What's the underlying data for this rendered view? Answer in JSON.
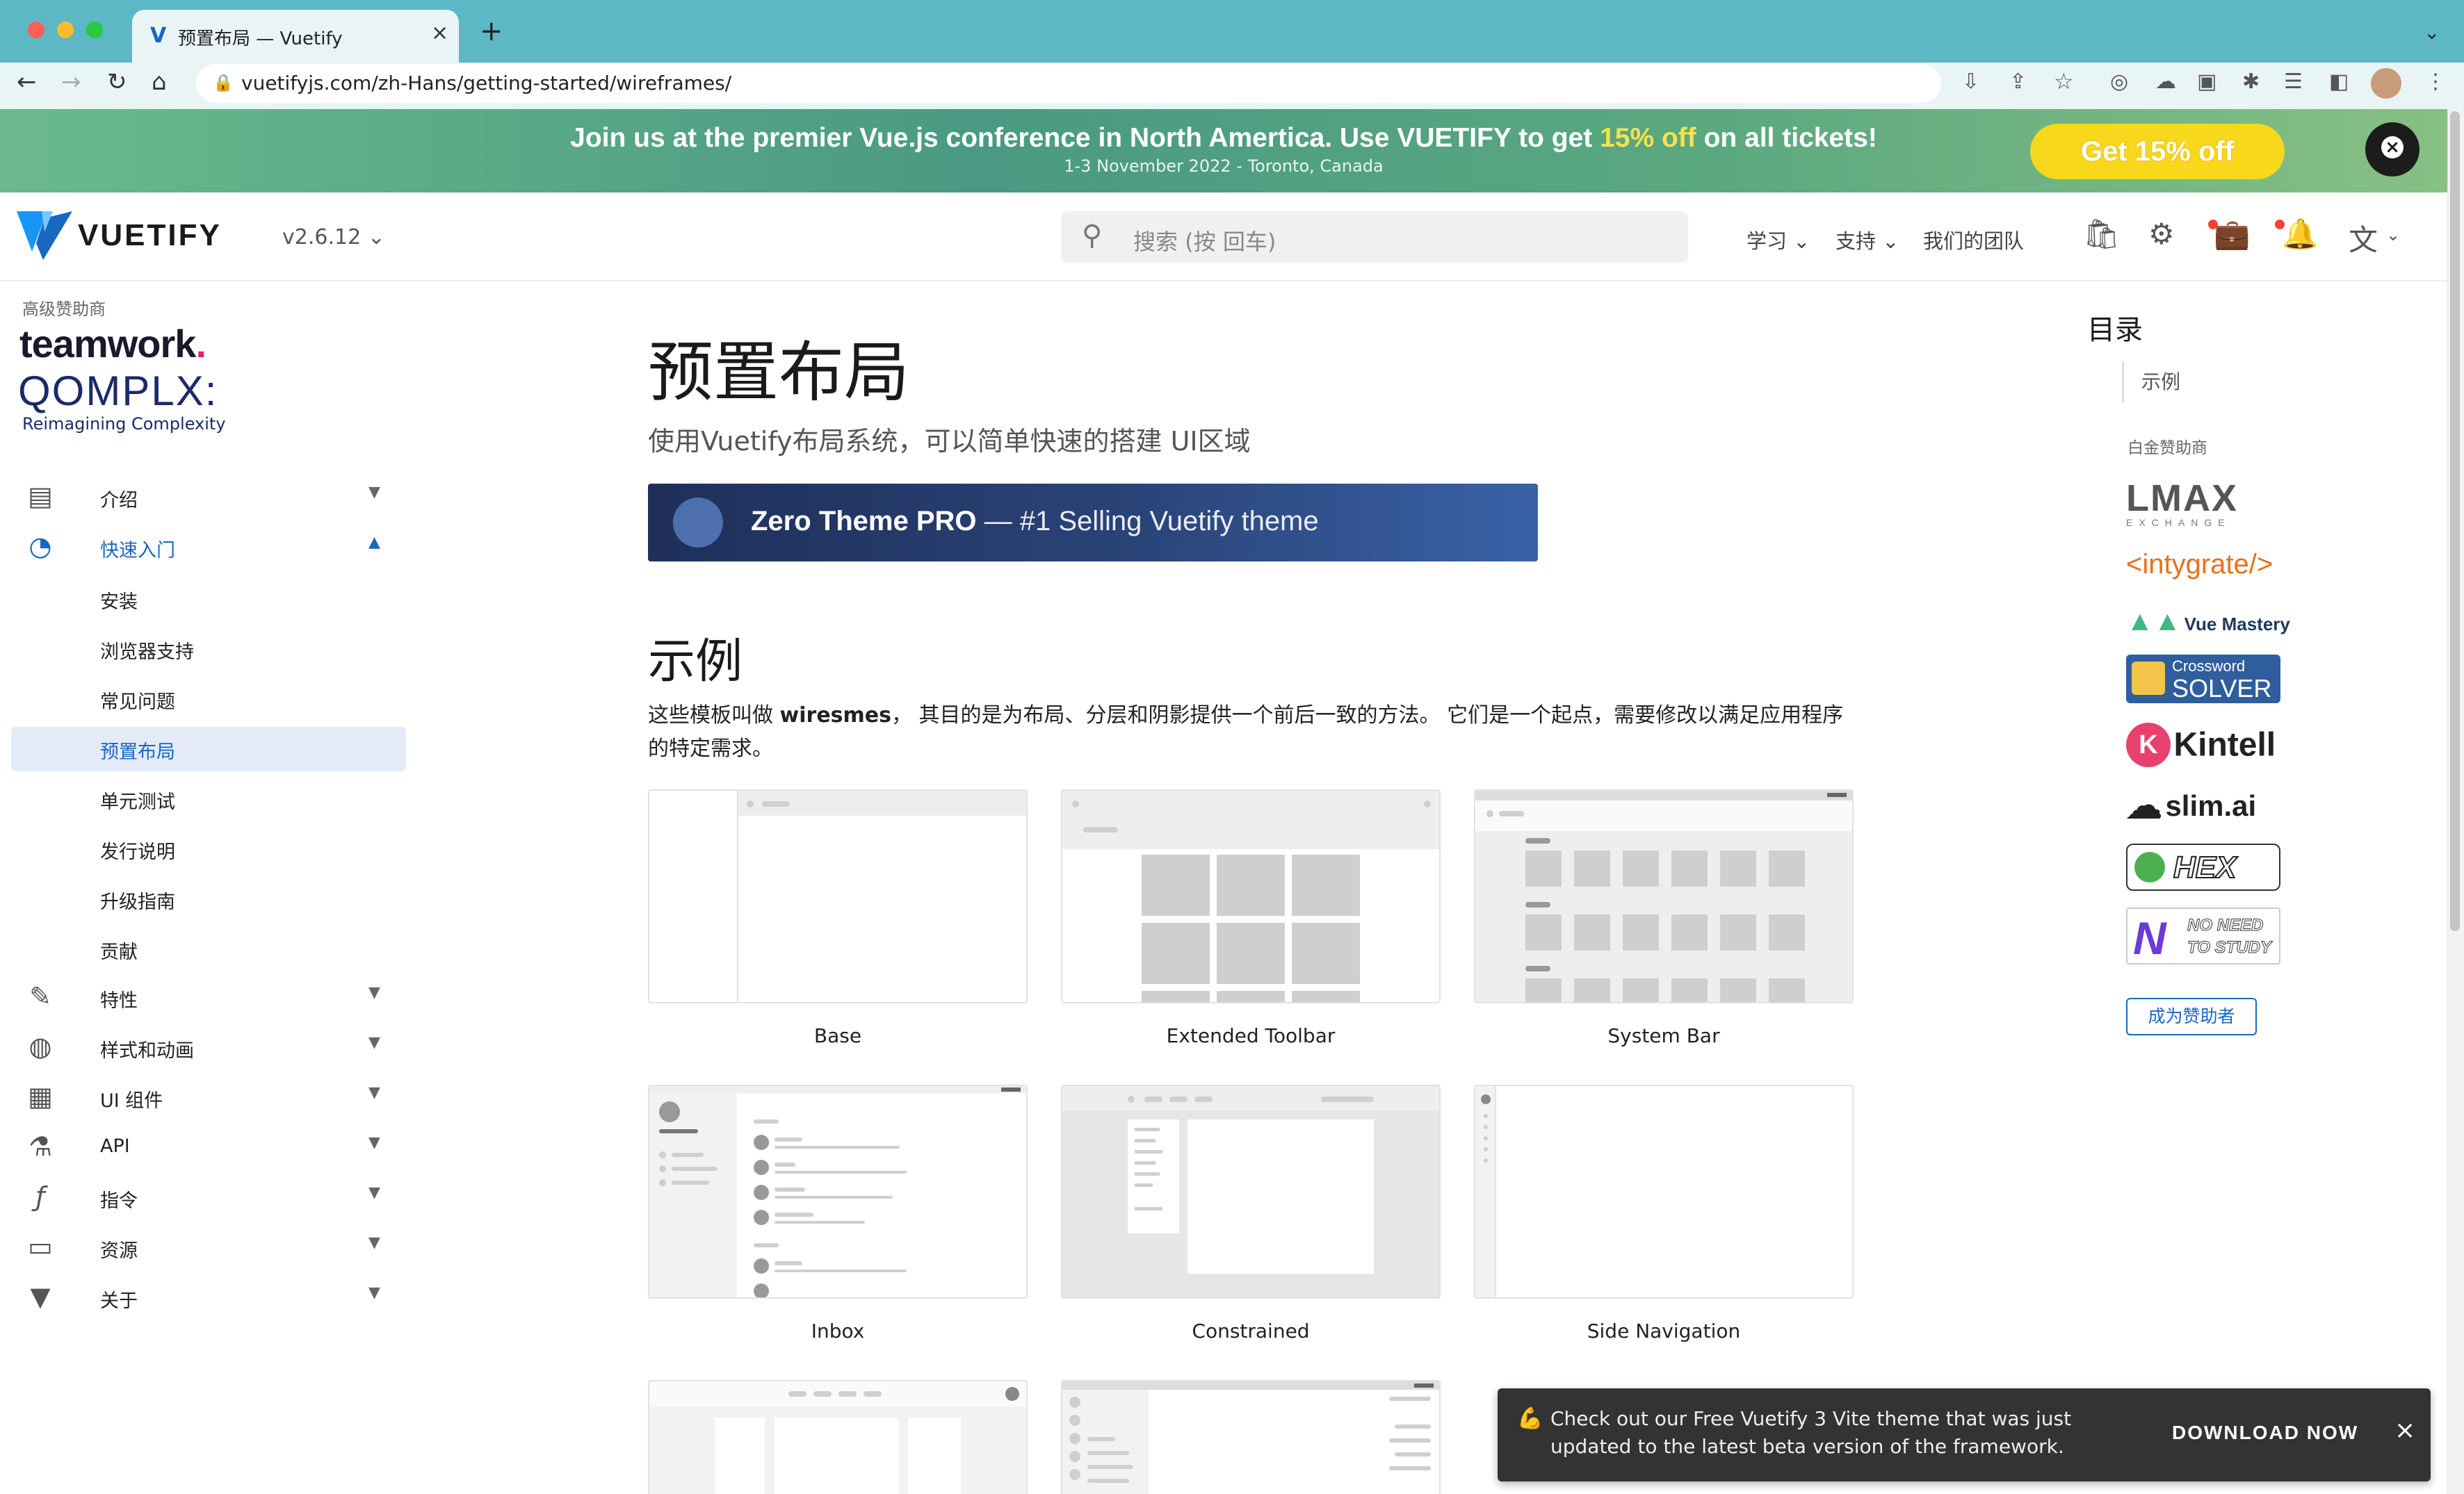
{
  "browser": {
    "tab_title": "预置布局 — Vuetify",
    "url": "vuetifyjs.com/zh-Hans/getting-started/wireframes/",
    "new_tab": "+",
    "back": "←",
    "forward": "→",
    "reload": "↻",
    "home": "⌂"
  },
  "promo": {
    "text_before": "Join us at the premier Vue.js conference in North Amertica. Use VUETIFY to get ",
    "highlight": "15% off",
    "text_after": " on all tickets!",
    "subtitle": "1-3 November 2022 - Toronto, Canada",
    "button": "Get 15% off",
    "close": "×",
    "accent": "#f7d81c"
  },
  "header": {
    "brand": "VUETIFY",
    "version": "v2.6.12",
    "search_placeholder": "搜索 (按 回车)",
    "nav": [
      "学习",
      "支持",
      "我们的团队"
    ]
  },
  "sidebar": {
    "premium_title": "高级赞助商",
    "sponsor1": "teamwork",
    "sponsor2": "QOMPLX:",
    "sponsor2_tagline": "Reimagining Complexity",
    "items": [
      {
        "label": "介绍",
        "icon": "book-icon"
      },
      {
        "label": "快速入门",
        "icon": "speedometer-icon"
      },
      {
        "label": "特性",
        "icon": "pencil-icon"
      },
      {
        "label": "样式和动画",
        "icon": "palette-icon"
      },
      {
        "label": "UI 组件",
        "icon": "grid-icon"
      },
      {
        "label": "API",
        "icon": "flask-icon"
      },
      {
        "label": "指令",
        "icon": "function-icon"
      },
      {
        "label": "资源",
        "icon": "presenter-icon"
      },
      {
        "label": "关于",
        "icon": "vuetify-icon"
      }
    ],
    "sub_items": [
      "安装",
      "浏览器支持",
      "常见问题",
      "预置布局",
      "单元测试",
      "发行说明",
      "升级指南",
      "贡献"
    ]
  },
  "main": {
    "title": "预置布局",
    "lead": "使用Vuetify布局系统，可以简单快速的搭建 UI区域",
    "banner_brand": "Zero Theme PRO",
    "banner_tail": " — #1 Selling Vuetify theme",
    "examples_title": "示例",
    "desc_before": "这些模板叫做 ",
    "desc_bold": "wiresmes",
    "desc_after": "， 其目的是为布局、分层和阴影提供一个前后一致的方法。 它们是一个起点，需要修改以满足应用程序的特定需求。",
    "cards": [
      "Base",
      "Extended Toolbar",
      "System Bar",
      "Inbox",
      "Constrained",
      "Side Navigation"
    ]
  },
  "toc": {
    "title": "目录",
    "items": [
      "示例"
    ],
    "platinum_title": "白金赞助商",
    "sponsors": [
      "LMAX",
      "EXCHANGE",
      "<intygrate/>",
      "Vue Mastery",
      "Crossword",
      "SOLVER",
      "Kintell",
      "slim.ai",
      "HEX",
      "NO NEED",
      "TO STUDY"
    ],
    "become_sponsor": "成为赞助者"
  },
  "snackbar": {
    "message": "Check out our Free Vuetify 3 Vite theme that was just updated to the latest beta version of the framework.",
    "action": "DOWNLOAD NOW",
    "close": "×"
  },
  "colors": {
    "primary": "#1867c0",
    "active_bg": "#e4ebf7"
  }
}
